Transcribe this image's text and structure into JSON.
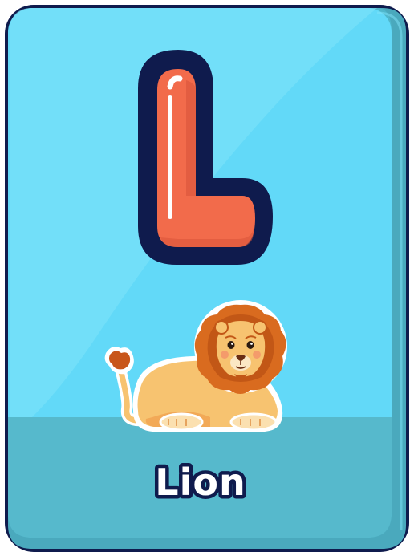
{
  "card": {
    "letter": "L",
    "word": "Lion",
    "picture": "lion",
    "colors": {
      "card_fill": "#62d9f8",
      "card_shadow": "#4fb7cc",
      "bottom_band": "#56b9cc",
      "outline": "#0f1b4d",
      "letter_fill": "#f26b4b",
      "lion_mane": "#d96b1f",
      "lion_body": "#f7c370"
    }
  }
}
